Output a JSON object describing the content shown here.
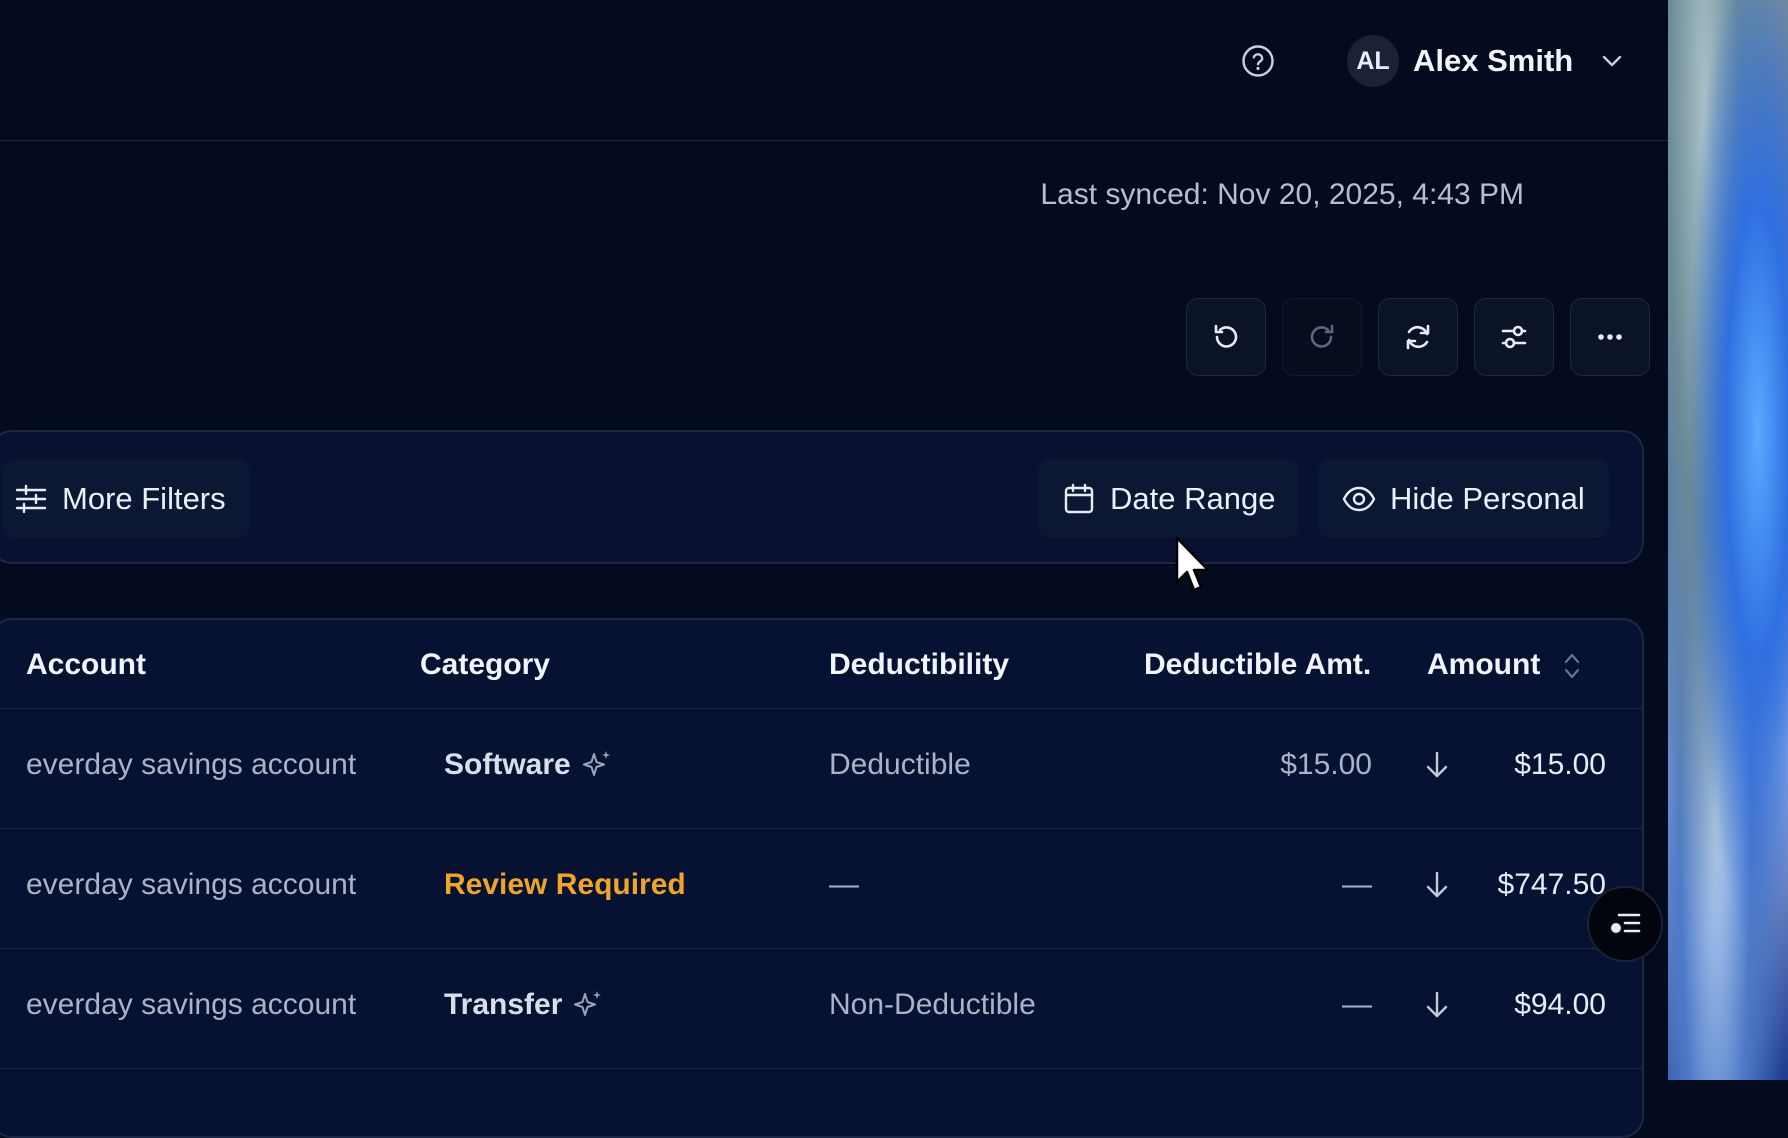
{
  "header": {
    "user": {
      "initials": "AL",
      "name": "Alex Smith"
    }
  },
  "sync": {
    "text": "Last synced: Nov 20, 2025, 4:43 PM"
  },
  "toolbar": {
    "buttons": [
      {
        "icon": "undo-icon"
      },
      {
        "icon": "redo-icon",
        "disabled": true
      },
      {
        "icon": "refresh-icon"
      },
      {
        "icon": "sliders-icon"
      },
      {
        "icon": "more-icon"
      }
    ]
  },
  "filters": {
    "more_label": "More Filters",
    "date_label": "Date Range",
    "hide_label": "Hide Personal"
  },
  "table": {
    "columns": [
      "Account",
      "Category",
      "Deductibility",
      "Deductible Amt.",
      "Amount"
    ],
    "rows": [
      {
        "account": "everday savings account",
        "category": "Software",
        "deductibility": "Deductible",
        "deductible_amt": "$15.00",
        "amount": "$15.00"
      },
      {
        "account": "everday savings account",
        "category": "Review Required",
        "deductibility": "—",
        "deductible_amt": "—",
        "amount": "$747.50"
      },
      {
        "account": "everday savings account",
        "category": "Transfer",
        "deductibility": "Non-Deductible",
        "deductible_amt": "—",
        "amount": "$94.00"
      }
    ]
  },
  "colors": {
    "background": "#050b1e",
    "panel": "#081230",
    "review_required": "#f0a42a"
  }
}
